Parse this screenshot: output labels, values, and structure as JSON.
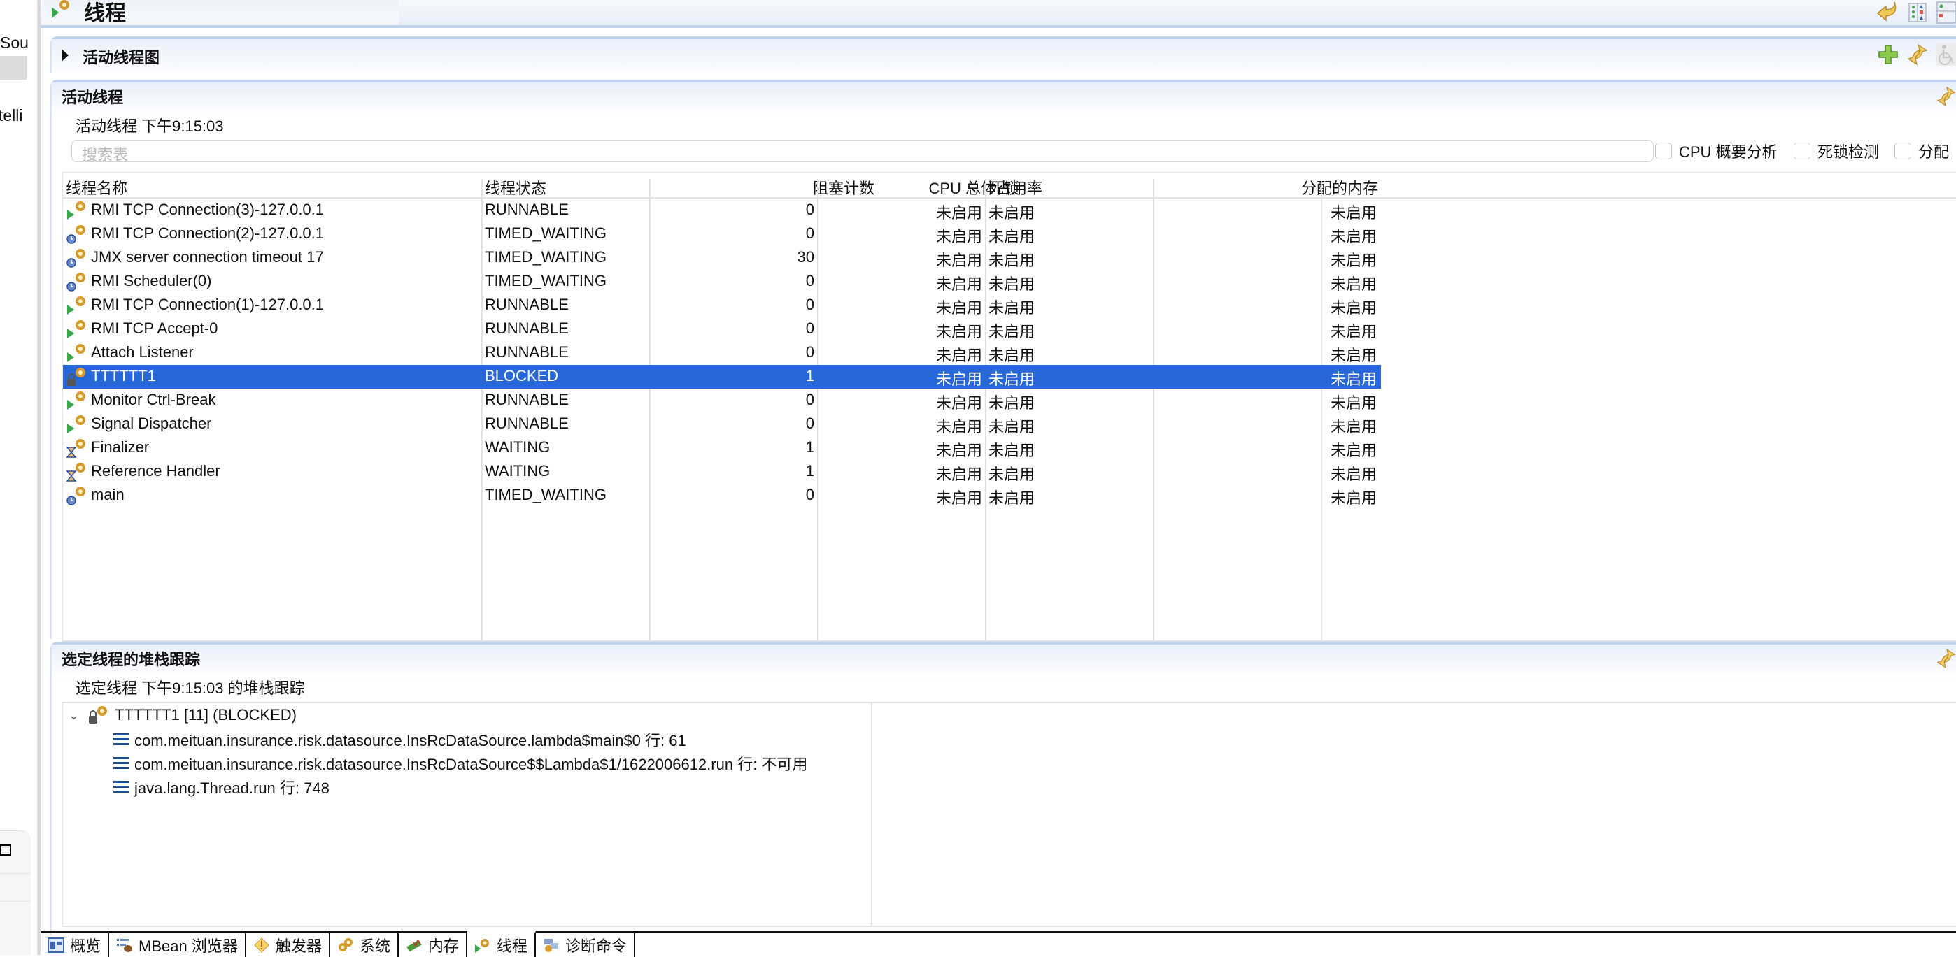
{
  "left_strip": {
    "fragments": [
      "Sou",
      "telli"
    ]
  },
  "title_bar": {
    "title": "线程",
    "icons": [
      "undo-arrow-icon",
      "layout-columns-icon",
      "layout-rows-icon"
    ]
  },
  "graph_section": {
    "label": "活动线程图",
    "tools": [
      "add-icon",
      "refresh-icon",
      "accessibility-icon"
    ]
  },
  "threads_section": {
    "label": "活动线程",
    "timestamp_label": "活动线程 下午9:15:03",
    "search_placeholder": "搜索表",
    "checkboxes": [
      {
        "label": "CPU 概要分析",
        "checked": false
      },
      {
        "label": "死锁检测",
        "checked": false
      },
      {
        "label": "分配",
        "checked": false
      }
    ],
    "columns": [
      "线程名称",
      "线程状态",
      "阻塞计数",
      "CPU 总体占用率",
      "死锁",
      "分配的内存"
    ],
    "rows": [
      {
        "icon": "runnable-thread-icon",
        "name": "RMI TCP Connection(3)-127.0.0.1",
        "state": "RUNNABLE",
        "blocked": "0",
        "cpu": "未启用",
        "deadlock": "未启用",
        "memory": "未启用"
      },
      {
        "icon": "timed-waiting-thread-icon",
        "name": "RMI TCP Connection(2)-127.0.0.1",
        "state": "TIMED_WAITING",
        "blocked": "0",
        "cpu": "未启用",
        "deadlock": "未启用",
        "memory": "未启用"
      },
      {
        "icon": "timed-waiting-thread-icon",
        "name": "JMX server connection timeout 17",
        "state": "TIMED_WAITING",
        "blocked": "30",
        "cpu": "未启用",
        "deadlock": "未启用",
        "memory": "未启用"
      },
      {
        "icon": "timed-waiting-thread-icon",
        "name": "RMI Scheduler(0)",
        "state": "TIMED_WAITING",
        "blocked": "0",
        "cpu": "未启用",
        "deadlock": "未启用",
        "memory": "未启用"
      },
      {
        "icon": "runnable-thread-icon",
        "name": "RMI TCP Connection(1)-127.0.0.1",
        "state": "RUNNABLE",
        "blocked": "0",
        "cpu": "未启用",
        "deadlock": "未启用",
        "memory": "未启用"
      },
      {
        "icon": "runnable-thread-icon",
        "name": "RMI TCP Accept-0",
        "state": "RUNNABLE",
        "blocked": "0",
        "cpu": "未启用",
        "deadlock": "未启用",
        "memory": "未启用"
      },
      {
        "icon": "runnable-thread-icon",
        "name": "Attach Listener",
        "state": "RUNNABLE",
        "blocked": "0",
        "cpu": "未启用",
        "deadlock": "未启用",
        "memory": "未启用"
      },
      {
        "icon": "blocked-thread-icon",
        "name": "TTTTTT1",
        "state": "BLOCKED",
        "blocked": "1",
        "cpu": "未启用",
        "deadlock": "未启用",
        "memory": "未启用",
        "selected": true
      },
      {
        "icon": "runnable-thread-icon",
        "name": "Monitor Ctrl-Break",
        "state": "RUNNABLE",
        "blocked": "0",
        "cpu": "未启用",
        "deadlock": "未启用",
        "memory": "未启用"
      },
      {
        "icon": "runnable-thread-icon",
        "name": "Signal Dispatcher",
        "state": "RUNNABLE",
        "blocked": "0",
        "cpu": "未启用",
        "deadlock": "未启用",
        "memory": "未启用"
      },
      {
        "icon": "waiting-thread-icon",
        "name": "Finalizer",
        "state": "WAITING",
        "blocked": "1",
        "cpu": "未启用",
        "deadlock": "未启用",
        "memory": "未启用"
      },
      {
        "icon": "waiting-thread-icon",
        "name": "Reference Handler",
        "state": "WAITING",
        "blocked": "1",
        "cpu": "未启用",
        "deadlock": "未启用",
        "memory": "未启用"
      },
      {
        "icon": "timed-waiting-thread-icon",
        "name": "main",
        "state": "TIMED_WAITING",
        "blocked": "0",
        "cpu": "未启用",
        "deadlock": "未启用",
        "memory": "未启用"
      }
    ]
  },
  "stack_section": {
    "label": "选定线程的堆栈跟踪",
    "timestamp_label": "选定线程 下午9:15:03 的堆栈跟踪",
    "thread_node": "TTTTTT1 [11] (BLOCKED)",
    "frames": [
      "com.meituan.insurance.risk.datasource.InsRcDataSource.lambda$main$0 行: 61",
      "com.meituan.insurance.risk.datasource.InsRcDataSource$$Lambda$1/1622006612.run 行: 不可用",
      "java.lang.Thread.run 行: 748"
    ]
  },
  "bottom_tabs": [
    {
      "label": "概览",
      "icon": "overview-icon"
    },
    {
      "label": "MBean 浏览器",
      "icon": "mbean-browser-icon"
    },
    {
      "label": "触发器",
      "icon": "trigger-icon"
    },
    {
      "label": "系统",
      "icon": "system-icon"
    },
    {
      "label": "内存",
      "icon": "memory-icon"
    },
    {
      "label": "线程",
      "icon": "threads-icon",
      "active": true
    },
    {
      "label": "诊断命令",
      "icon": "diagnostic-commands-icon"
    }
  ],
  "colors": {
    "selection": "#2867d8",
    "section_border": "#c2d3ee",
    "header_gradient_top": "#e8eefa"
  }
}
